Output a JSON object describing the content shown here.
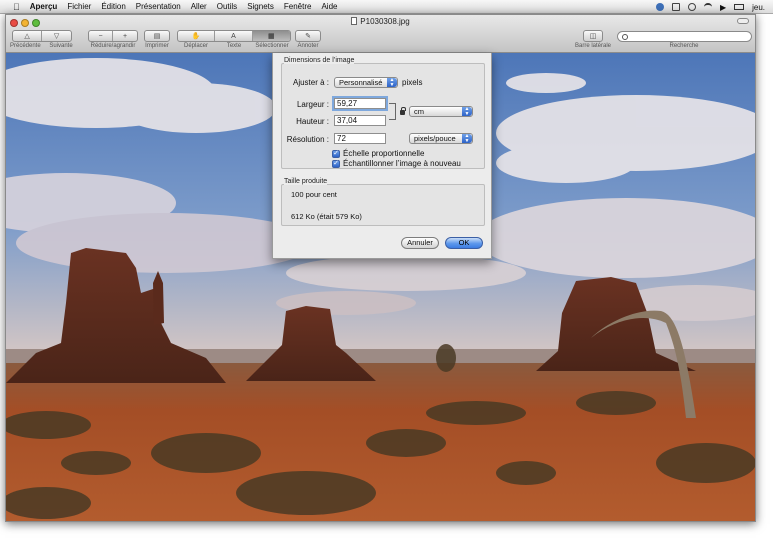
{
  "menubar": {
    "items": [
      {
        "label": "Aperçu",
        "bold": true
      },
      {
        "label": "Fichier"
      },
      {
        "label": "Édition"
      },
      {
        "label": "Présentation"
      },
      {
        "label": "Aller"
      },
      {
        "label": "Outils"
      },
      {
        "label": "Signets"
      },
      {
        "label": "Fenêtre"
      },
      {
        "label": "Aide"
      }
    ],
    "clock": "jeu."
  },
  "window": {
    "title": "P1030308.jpg",
    "toolbar": {
      "labels": {
        "previous": "Précédente",
        "next": "Suivante",
        "zoom": "Réduire/agrandir",
        "print": "Imprimer",
        "move": "Déplacer",
        "text": "Texte",
        "select": "Sélectionner",
        "annotate": "Annoter",
        "sidebar": "Barre latérale",
        "search": "Recherche"
      }
    }
  },
  "dialog": {
    "dimensions_title": "Dimensions de l’image",
    "fit_label": "Ajuster à :",
    "fit_value": "Personnalisé",
    "fit_unit": "pixels",
    "width_label": "Largeur :",
    "width_value": "59,27",
    "height_label": "Hauteur :",
    "height_value": "37,04",
    "unit_value": "cm",
    "resolution_label": "Résolution :",
    "resolution_value": "72",
    "resolution_unit": "pixels/pouce",
    "scale_label": "Échelle proportionnelle",
    "resample_label": "Échantillonner l’image à nouveau",
    "result_title": "Taille produite",
    "result_percent": "100 pour cent",
    "result_size": "612 Ko (était 579 Ko)",
    "cancel_label": "Annuler",
    "ok_label": "OK"
  },
  "colors": {
    "accent": "#3c7ce2",
    "sky": "#5f86c4",
    "ground": "#a5502a"
  }
}
